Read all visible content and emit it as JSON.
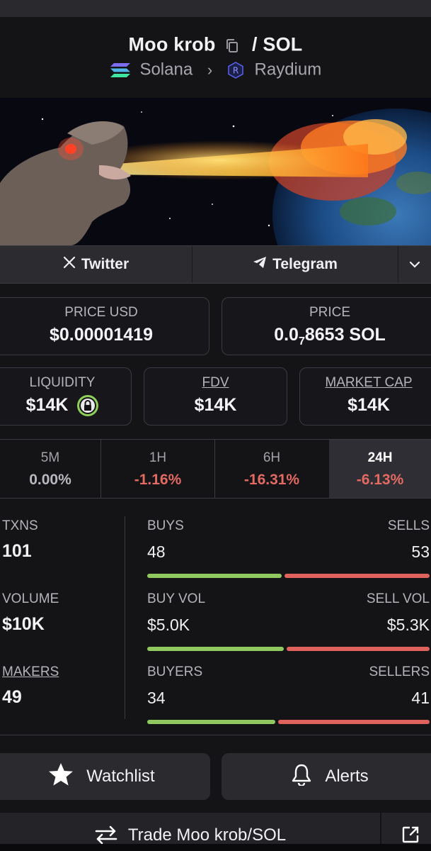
{
  "header": {
    "token_name": "Moo krob",
    "quote_symbol": "/ SOL",
    "chain": "Solana",
    "dex": "Raydium"
  },
  "links": {
    "twitter_label": "Twitter",
    "telegram_label": "Telegram"
  },
  "price": {
    "usd_label": "PRICE USD",
    "usd_value": "$0.00001419",
    "native_label": "PRICE",
    "native_prefix": "0.0",
    "native_subscript": "7",
    "native_suffix": "8653 SOL"
  },
  "metrics": {
    "liquidity_label": "LIQUIDITY",
    "liquidity_value": "$14K",
    "fdv_label": "FDV",
    "fdv_value": "$14K",
    "mcap_label": "MARKET CAP",
    "mcap_value": "$14K"
  },
  "timeframes": [
    {
      "label": "5M",
      "value": "0.00%"
    },
    {
      "label": "1H",
      "value": "-1.16%"
    },
    {
      "label": "6H",
      "value": "-16.31%"
    },
    {
      "label": "24H",
      "value": "-6.13%"
    }
  ],
  "stats": {
    "txns_label": "TXNS",
    "txns_value": "101",
    "buys_label": "BUYS",
    "buys_value": "48",
    "sells_label": "SELLS",
    "sells_value": "53",
    "volume_label": "VOLUME",
    "volume_value": "$10K",
    "buy_vol_label": "BUY VOL",
    "buy_vol_value": "$5.0K",
    "sell_vol_label": "SELL VOL",
    "sell_vol_value": "$5.3K",
    "makers_label": "MAKERS",
    "makers_value": "49",
    "buyers_label": "BUYERS",
    "buyers_value": "34",
    "sellers_label": "SELLERS",
    "sellers_value": "41"
  },
  "actions": {
    "watchlist_label": "Watchlist",
    "alerts_label": "Alerts",
    "trade_label": "Trade Moo krob/SOL"
  },
  "colors": {
    "buy": "#8fc960",
    "sell": "#e0625c",
    "negative_text": "#e26a62"
  }
}
